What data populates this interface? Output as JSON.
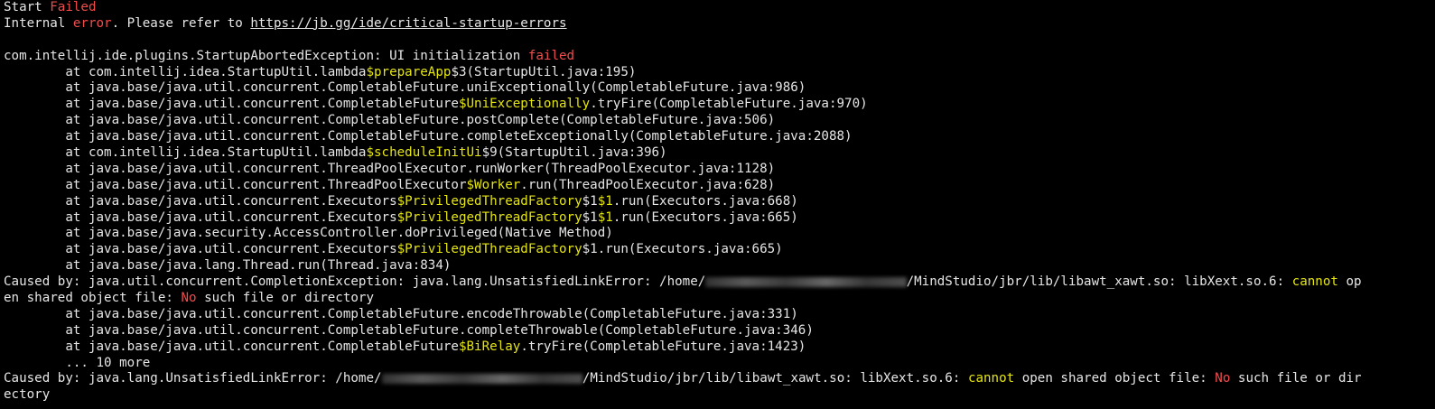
{
  "colors": {
    "background": "#000000",
    "foreground": "#e6e6e6",
    "error_red": "#f14c4c",
    "highlight_yellow": "#e5e510"
  },
  "lines": [
    [
      {
        "t": "Start "
      },
      {
        "t": "Failed",
        "c": "red"
      }
    ],
    [
      {
        "t": "Internal "
      },
      {
        "t": "error",
        "c": "red"
      },
      {
        "t": ". Please refer to "
      },
      {
        "t": "https://jb.gg/ide/critical-startup-errors",
        "c": "link"
      }
    ],
    [],
    [
      {
        "t": "com.intellij.ide.plugins.StartupAbortedException: UI initialization "
      },
      {
        "t": "failed",
        "c": "red"
      }
    ],
    [
      {
        "t": "        at com.intellij.idea.StartupUtil.lambda"
      },
      {
        "t": "$prepareApp",
        "c": "yellow"
      },
      {
        "t": "$3(StartupUtil.java:195)"
      }
    ],
    [
      {
        "t": "        at java.base/java.util.concurrent.CompletableFuture.uniExceptionally(CompletableFuture.java:986)"
      }
    ],
    [
      {
        "t": "        at java.base/java.util.concurrent.CompletableFuture"
      },
      {
        "t": "$UniExceptionally",
        "c": "yellow"
      },
      {
        "t": ".tryFire(CompletableFuture.java:970)"
      }
    ],
    [
      {
        "t": "        at java.base/java.util.concurrent.CompletableFuture.postComplete(CompletableFuture.java:506)"
      }
    ],
    [
      {
        "t": "        at java.base/java.util.concurrent.CompletableFuture.completeExceptionally(CompletableFuture.java:2088)"
      }
    ],
    [
      {
        "t": "        at com.intellij.idea.StartupUtil.lambda"
      },
      {
        "t": "$scheduleInitUi",
        "c": "yellow"
      },
      {
        "t": "$9(StartupUtil.java:396)"
      }
    ],
    [
      {
        "t": "        at java.base/java.util.concurrent.ThreadPoolExecutor.runWorker(ThreadPoolExecutor.java:1128)"
      }
    ],
    [
      {
        "t": "        at java.base/java.util.concurrent.ThreadPoolExecutor"
      },
      {
        "t": "$Worker",
        "c": "yellow"
      },
      {
        "t": ".run(ThreadPoolExecutor.java:628)"
      }
    ],
    [
      {
        "t": "        at java.base/java.util.concurrent.Executors"
      },
      {
        "t": "$PrivilegedThreadFactory",
        "c": "yellow"
      },
      {
        "t": "$1"
      },
      {
        "t": "$1",
        "c": "yellow"
      },
      {
        "t": ".run(Executors.java:668)"
      }
    ],
    [
      {
        "t": "        at java.base/java.util.concurrent.Executors"
      },
      {
        "t": "$PrivilegedThreadFactory",
        "c": "yellow"
      },
      {
        "t": "$1"
      },
      {
        "t": "$1",
        "c": "yellow"
      },
      {
        "t": ".run(Executors.java:665)"
      }
    ],
    [
      {
        "t": "        at java.base/java.security.AccessController.doPrivileged(Native Method)"
      }
    ],
    [
      {
        "t": "        at java.base/java.util.concurrent.Executors"
      },
      {
        "t": "$PrivilegedThreadFactory",
        "c": "yellow"
      },
      {
        "t": "$1.run(Executors.java:665)"
      }
    ],
    [
      {
        "t": "        at java.base/java.lang.Thread.run(Thread.java:834)"
      }
    ],
    [
      {
        "t": "Caused by: java.util.concurrent.CompletionException: java.lang.UnsatisfiedLinkError: /home/"
      },
      {
        "blur": 26
      },
      {
        "t": "/MindStudio/jbr/lib/libawt_xawt.so: libXext.so.6: "
      },
      {
        "t": "cannot",
        "c": "yellow"
      },
      {
        "t": " op"
      }
    ],
    [
      {
        "t": "en shared object file: "
      },
      {
        "t": "No",
        "c": "red"
      },
      {
        "t": " such file or directory"
      }
    ],
    [
      {
        "t": "        at java.base/java.util.concurrent.CompletableFuture.encodeThrowable(CompletableFuture.java:331)"
      }
    ],
    [
      {
        "t": "        at java.base/java.util.concurrent.CompletableFuture.completeThrowable(CompletableFuture.java:346)"
      }
    ],
    [
      {
        "t": "        at java.base/java.util.concurrent.CompletableFuture"
      },
      {
        "t": "$BiRelay",
        "c": "yellow"
      },
      {
        "t": ".tryFire(CompletableFuture.java:1423)"
      }
    ],
    [
      {
        "t": "        ... 10 more"
      }
    ],
    [
      {
        "t": "Caused by: java.lang.UnsatisfiedLinkError: /home/"
      },
      {
        "blur": 26
      },
      {
        "t": "/MindStudio/jbr/lib/libawt_xawt.so: libXext.so.6: "
      },
      {
        "t": "cannot",
        "c": "yellow"
      },
      {
        "t": " open shared object file: "
      },
      {
        "t": "No",
        "c": "red"
      },
      {
        "t": " such file or dir"
      }
    ],
    [
      {
        "t": "ectory"
      }
    ]
  ]
}
